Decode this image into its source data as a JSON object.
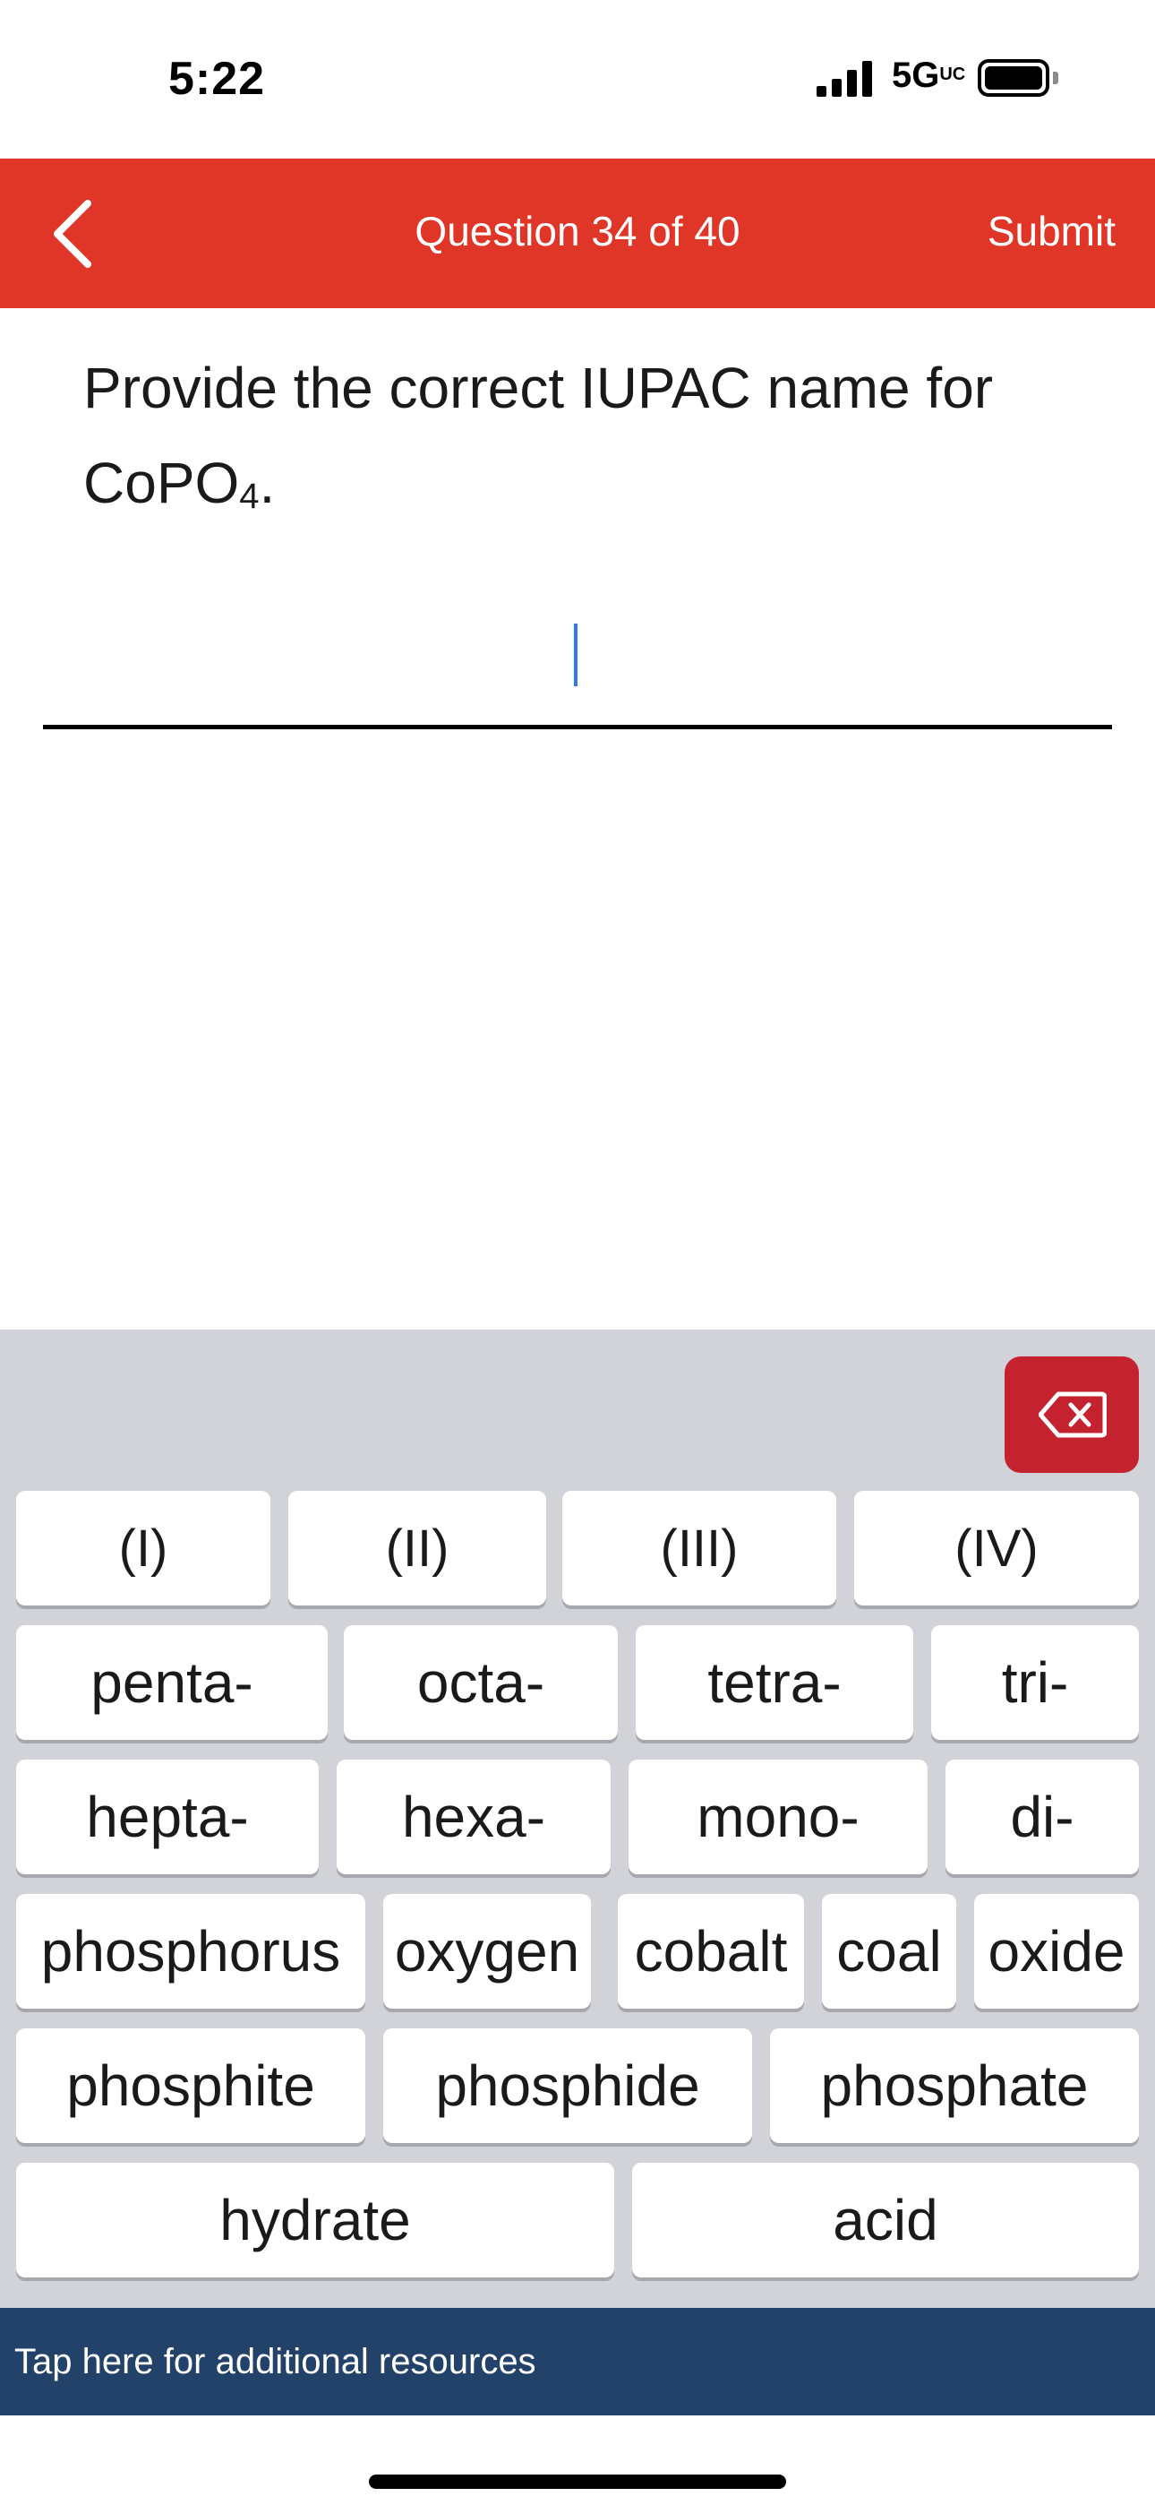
{
  "status_bar": {
    "time": "5:22",
    "network": "5G",
    "network_suffix": "UC"
  },
  "header": {
    "title": "Question 34 of 40",
    "submit_label": "Submit",
    "accent_color": "#e03628"
  },
  "question": {
    "text_prefix": "Provide the correct IUPAC name for CoPO",
    "subscript": "4",
    "text_suffix": "."
  },
  "answer": {
    "value": ""
  },
  "keyboard": {
    "roman_row": [
      "(I)",
      "(II)",
      "(III)",
      "(IV)"
    ],
    "prefix_row1": [
      "penta-",
      "octa-",
      "tetra-",
      "tri-"
    ],
    "prefix_row2": [
      "hepta-",
      "hexa-",
      "mono-",
      "di-"
    ],
    "word_row1": [
      "phosphorus",
      "oxygen",
      "cobalt",
      "coal",
      "oxide"
    ],
    "word_row2": [
      "phosphite",
      "phosphide",
      "phosphate"
    ],
    "word_row3": [
      "hydrate",
      "acid"
    ],
    "backspace_color": "#c4222f"
  },
  "footer": {
    "resources_label": "Tap here for additional resources",
    "bar_color": "#23426a"
  }
}
